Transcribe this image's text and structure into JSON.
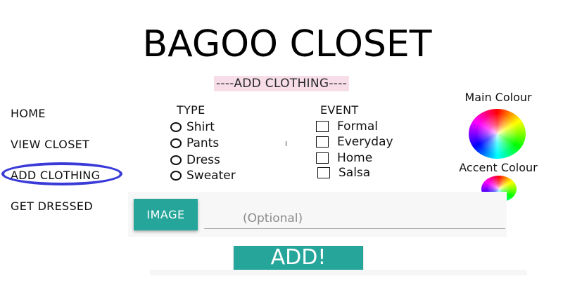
{
  "app": {
    "title": "BAGOO CLOSET",
    "subtitle": "----ADD CLOTHING----"
  },
  "nav": {
    "items": [
      {
        "label": "HOME"
      },
      {
        "label": "VIEW CLOSET"
      },
      {
        "label": "ADD CLOTHING",
        "active": true
      },
      {
        "label": "GET DRESSED"
      }
    ]
  },
  "type_group": {
    "heading": "TYPE",
    "options": [
      {
        "label": "Shirt"
      },
      {
        "label": "Pants"
      },
      {
        "label": "Dress"
      },
      {
        "label": "Sweater"
      }
    ]
  },
  "event_group": {
    "heading": "EVENT",
    "options": [
      {
        "label": "Formal"
      },
      {
        "label": "Everyday"
      },
      {
        "label": "Home"
      },
      {
        "label": "Salsa"
      }
    ]
  },
  "colours": {
    "main_label": "Main Colour",
    "accent_label": "Accent Colour"
  },
  "image": {
    "button_label": "IMAGE",
    "placeholder": "(Optional)"
  },
  "submit": {
    "label": "ADD!"
  },
  "theme": {
    "accent": "#26a69a",
    "subtitle_highlight": "#f7dde8",
    "active_ring": "#3a3ad8"
  }
}
